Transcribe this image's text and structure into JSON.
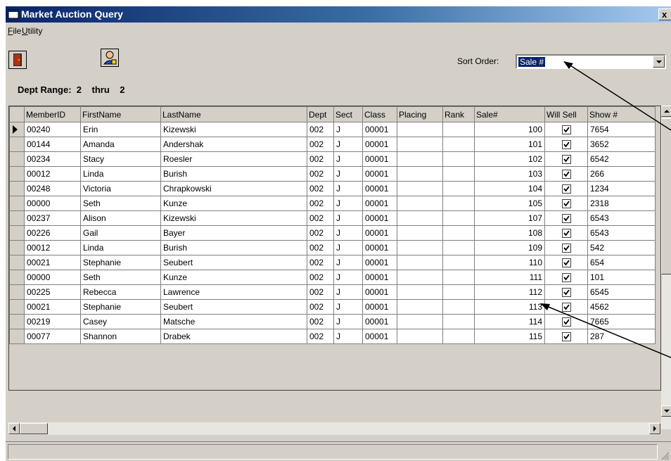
{
  "window": {
    "title": "Market Auction Query",
    "close_label": "x"
  },
  "menu": [
    {
      "label": "File",
      "key": "F",
      "rest": "ile"
    },
    {
      "label": "Utility",
      "key": "U",
      "rest": "tility"
    }
  ],
  "toolbar": {
    "exit_icon": "door-exit-icon",
    "user_icon": "person-search-icon"
  },
  "sort": {
    "label": "Sort Order:",
    "value": "Sale #"
  },
  "dept_range": {
    "label": "Dept Range:",
    "from": "2",
    "thru_label": "thru",
    "to": "2"
  },
  "grid": {
    "columns": [
      "MemberID",
      "FirstName",
      "LastName",
      "Dept",
      "Sect",
      "Class",
      "Placing",
      "Rank",
      "Sale#",
      "Will Sell",
      "Show #"
    ],
    "rows": [
      {
        "member_id": "00240",
        "first": "Erin",
        "last": "Kizewski",
        "dept": "002",
        "sect": "J",
        "class": "00001",
        "placing": "",
        "rank": "",
        "sale": "100",
        "will_sell": true,
        "show": "7654",
        "current": true
      },
      {
        "member_id": "00144",
        "first": "Amanda",
        "last": "Andershak",
        "dept": "002",
        "sect": "J",
        "class": "00001",
        "placing": "",
        "rank": "",
        "sale": "101",
        "will_sell": true,
        "show": "3652"
      },
      {
        "member_id": "00234",
        "first": "Stacy",
        "last": "Roesler",
        "dept": "002",
        "sect": "J",
        "class": "00001",
        "placing": "",
        "rank": "",
        "sale": "102",
        "will_sell": true,
        "show": "6542"
      },
      {
        "member_id": "00012",
        "first": "Linda",
        "last": "Burish",
        "dept": "002",
        "sect": "J",
        "class": "00001",
        "placing": "",
        "rank": "",
        "sale": "103",
        "will_sell": true,
        "show": "266"
      },
      {
        "member_id": "00248",
        "first": "Victoria",
        "last": "Chrapkowski",
        "dept": "002",
        "sect": "J",
        "class": "00001",
        "placing": "",
        "rank": "",
        "sale": "104",
        "will_sell": true,
        "show": "1234"
      },
      {
        "member_id": "00000",
        "first": "Seth",
        "last": "Kunze",
        "dept": "002",
        "sect": "J",
        "class": "00001",
        "placing": "",
        "rank": "",
        "sale": "105",
        "will_sell": true,
        "show": "2318"
      },
      {
        "member_id": "00237",
        "first": "Alison",
        "last": "Kizewski",
        "dept": "002",
        "sect": "J",
        "class": "00001",
        "placing": "",
        "rank": "",
        "sale": "107",
        "will_sell": true,
        "show": "6543"
      },
      {
        "member_id": "00226",
        "first": "Gail",
        "last": "Bayer",
        "dept": "002",
        "sect": "J",
        "class": "00001",
        "placing": "",
        "rank": "",
        "sale": "108",
        "will_sell": true,
        "show": "6543"
      },
      {
        "member_id": "00012",
        "first": "Linda",
        "last": "Burish",
        "dept": "002",
        "sect": "J",
        "class": "00001",
        "placing": "",
        "rank": "",
        "sale": "109",
        "will_sell": true,
        "show": "542"
      },
      {
        "member_id": "00021",
        "first": "Stephanie",
        "last": "Seubert",
        "dept": "002",
        "sect": "J",
        "class": "00001",
        "placing": "",
        "rank": "",
        "sale": "110",
        "will_sell": true,
        "show": "654"
      },
      {
        "member_id": "00000",
        "first": "Seth",
        "last": "Kunze",
        "dept": "002",
        "sect": "J",
        "class": "00001",
        "placing": "",
        "rank": "",
        "sale": "111",
        "will_sell": true,
        "show": "101"
      },
      {
        "member_id": "00225",
        "first": "Rebecca",
        "last": "Lawrence",
        "dept": "002",
        "sect": "J",
        "class": "00001",
        "placing": "",
        "rank": "",
        "sale": "112",
        "will_sell": true,
        "show": "6545"
      },
      {
        "member_id": "00021",
        "first": "Stephanie",
        "last": "Seubert",
        "dept": "002",
        "sect": "J",
        "class": "00001",
        "placing": "",
        "rank": "",
        "sale": "113",
        "will_sell": true,
        "show": "4562"
      },
      {
        "member_id": "00219",
        "first": "Casey",
        "last": "Matsche",
        "dept": "002",
        "sect": "J",
        "class": "00001",
        "placing": "",
        "rank": "",
        "sale": "114",
        "will_sell": true,
        "show": "7665"
      },
      {
        "member_id": "00077",
        "first": "Shannon",
        "last": "Drabek",
        "dept": "002",
        "sect": "J",
        "class": "00001",
        "placing": "",
        "rank": "",
        "sale": "115",
        "will_sell": true,
        "show": "287"
      }
    ]
  },
  "colors": {
    "titlebar_start": "#0a246a",
    "titlebar_end": "#a6caf0",
    "face": "#d4d0c8",
    "selection": "#0a246a"
  }
}
